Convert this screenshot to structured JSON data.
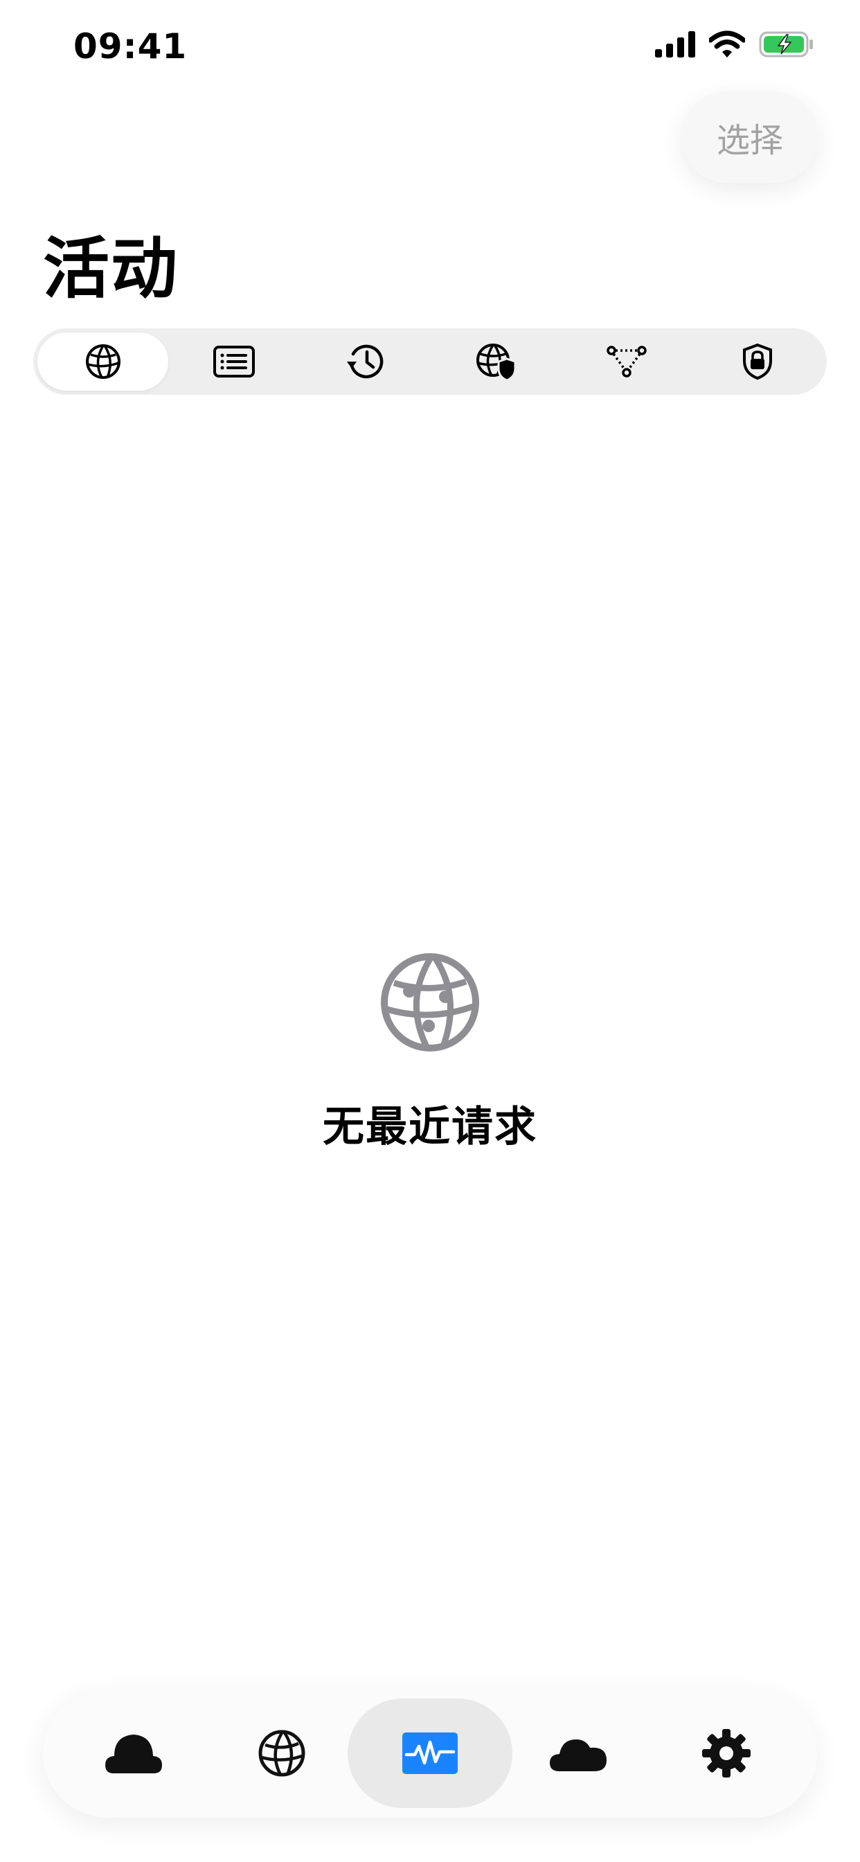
{
  "status_bar": {
    "time": "09:41",
    "icons": [
      "cellular-signal-icon",
      "wifi-icon",
      "battery-charging-icon"
    ],
    "battery_color": "#34c759"
  },
  "header": {
    "select_label": "选择",
    "title": "活动"
  },
  "segmented_control": {
    "items": [
      {
        "icon": "globe-icon",
        "selected": true
      },
      {
        "icon": "list-card-icon",
        "selected": false
      },
      {
        "icon": "history-clock-icon",
        "selected": false
      },
      {
        "icon": "globe-shield-icon",
        "selected": false
      },
      {
        "icon": "network-nodes-icon",
        "selected": false
      },
      {
        "icon": "lock-shield-icon",
        "selected": false
      }
    ]
  },
  "empty_state": {
    "icon": "globe-icon",
    "message": "无最近请求",
    "icon_color": "#8e8e93"
  },
  "tab_bar": {
    "items": [
      {
        "icon": "cloud-filled-icon",
        "selected": false
      },
      {
        "icon": "globe-icon",
        "selected": false
      },
      {
        "icon": "activity-icon",
        "selected": true
      },
      {
        "icon": "cloud-icon",
        "selected": false
      },
      {
        "icon": "gear-icon",
        "selected": false
      }
    ],
    "accent_color": "#1a84ff"
  }
}
